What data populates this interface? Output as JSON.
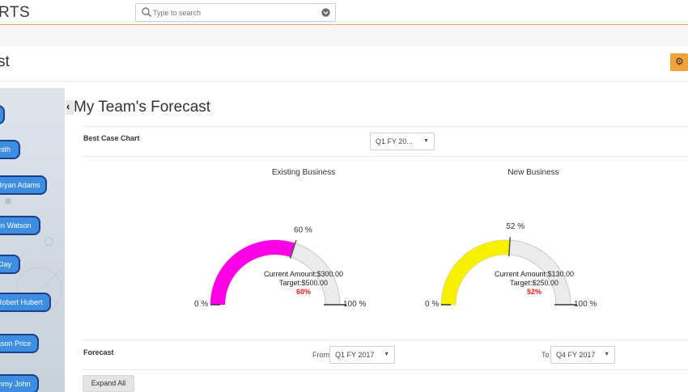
{
  "app": {
    "brand": "RTS"
  },
  "search": {
    "placeholder": "Type to search"
  },
  "page": {
    "title": "st"
  },
  "sidebar": {
    "nodes": [
      "",
      "mith",
      "Bryan Adams",
      "en Watson",
      "Clay",
      "Robert Hubert",
      "ason Price",
      "mmy John"
    ]
  },
  "main": {
    "heading": "My Team's Forecast",
    "best_case_label": "Best Case Chart",
    "quarter_select": "Q1 FY 20...",
    "forecast_label": "Forecast",
    "from_label": "From",
    "from_value": "Q1 FY 2017",
    "to_label": "To",
    "to_value": "Q4 FY 2017",
    "expand_all": "Expand All"
  },
  "gauges": [
    {
      "title": "Existing Business",
      "percent": 60,
      "percent_label": "60 %",
      "current": "Current Amount:$300.00",
      "target": "Target:$500.00",
      "pct_text": "60%",
      "min_label": "0 %",
      "max_label": "100 %",
      "color": "#ff00e6"
    },
    {
      "title": "New Business",
      "percent": 52,
      "percent_label": "52 %",
      "current": "Current Amount:$130.00",
      "target": "Target:$250.00",
      "pct_text": "52%",
      "min_label": "0 %",
      "max_label": "100 %",
      "color": "#f7f000"
    }
  ],
  "colors": {
    "accent": "#f0a23b",
    "node_fill": "#3d8de0",
    "node_border": "#1b3f8a",
    "pct_red": "#e01b1b"
  }
}
